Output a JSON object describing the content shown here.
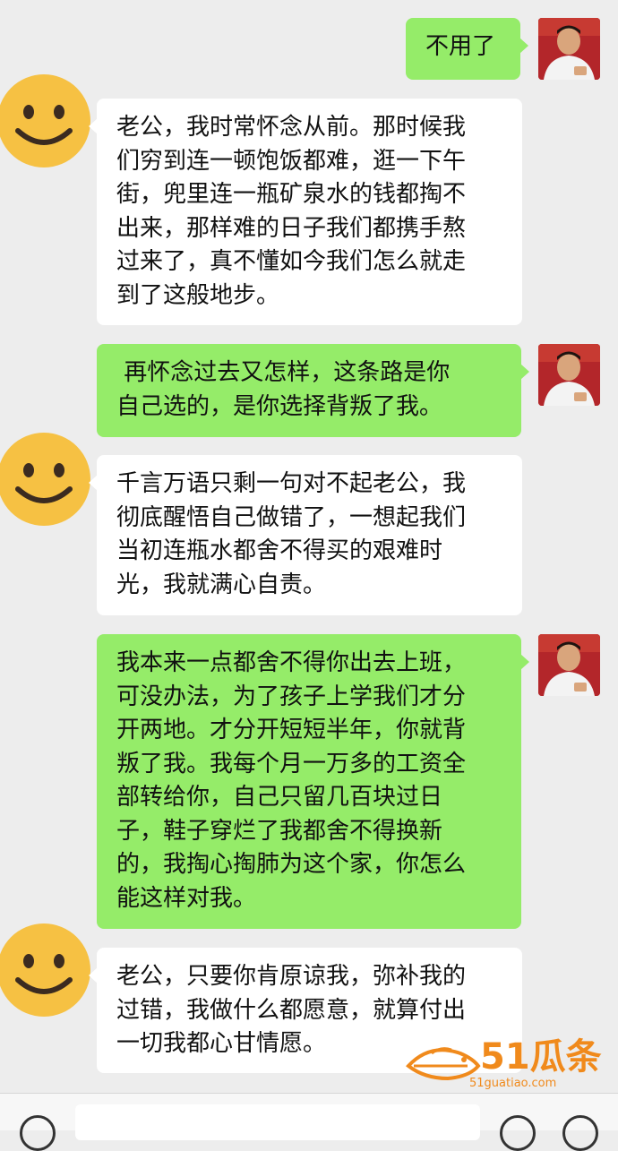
{
  "chat": {
    "messages": [
      {
        "side": "out",
        "sender": "husband",
        "text": "不用了"
      },
      {
        "side": "in",
        "sender": "wife",
        "text": "老公，我时常怀念从前。那时候我\n们穷到连一顿饱饭都难，逛一下午\n街，兜里连一瓶矿泉水的钱都掏不\n出来，那样难的日子我们都携手熬\n过来了，真不懂如今我们怎么就走\n到了这般地步。"
      },
      {
        "side": "out",
        "sender": "husband",
        "text": " 再怀念过去又怎样，这条路是你\n自己选的，是你选择背叛了我。"
      },
      {
        "side": "in",
        "sender": "wife",
        "text": "千言万语只剩一句对不起老公，我\n彻底醒悟自己做错了，一想起我们\n当初连瓶水都舍不得买的艰难时\n光，我就满心自责。"
      },
      {
        "side": "out",
        "sender": "husband",
        "text": "我本来一点都舍不得你出去上班，\n可没办法，为了孩子上学我们才分\n开两地。才分开短短半年，你就背\n叛了我。我每个月一万多的工资全\n部转给你，自己只留几百块过日\n子，鞋子穿烂了我都舍不得换新\n的，我掏心掏肺为这个家，你怎么\n能这样对我。"
      },
      {
        "side": "in",
        "sender": "wife",
        "text": "老公，只要你肯原谅我，弥补我的\n过错，我做什么都愿意，就算付出\n一切我都心甘情愿。"
      }
    ]
  },
  "watermark": {
    "logo_text": "51瓜条",
    "url": "51guatiao.com"
  },
  "colors": {
    "outgoing_bubble": "#95ec69",
    "incoming_bubble": "#ffffff",
    "background": "#ededed",
    "watermark": "#f08a1c"
  },
  "icons": {
    "husband_avatar": "man-photo-avatar",
    "wife_avatar": "smiley-face-avatar",
    "voice": "voice-icon",
    "emoji": "emoji-icon",
    "plus": "plus-icon"
  }
}
